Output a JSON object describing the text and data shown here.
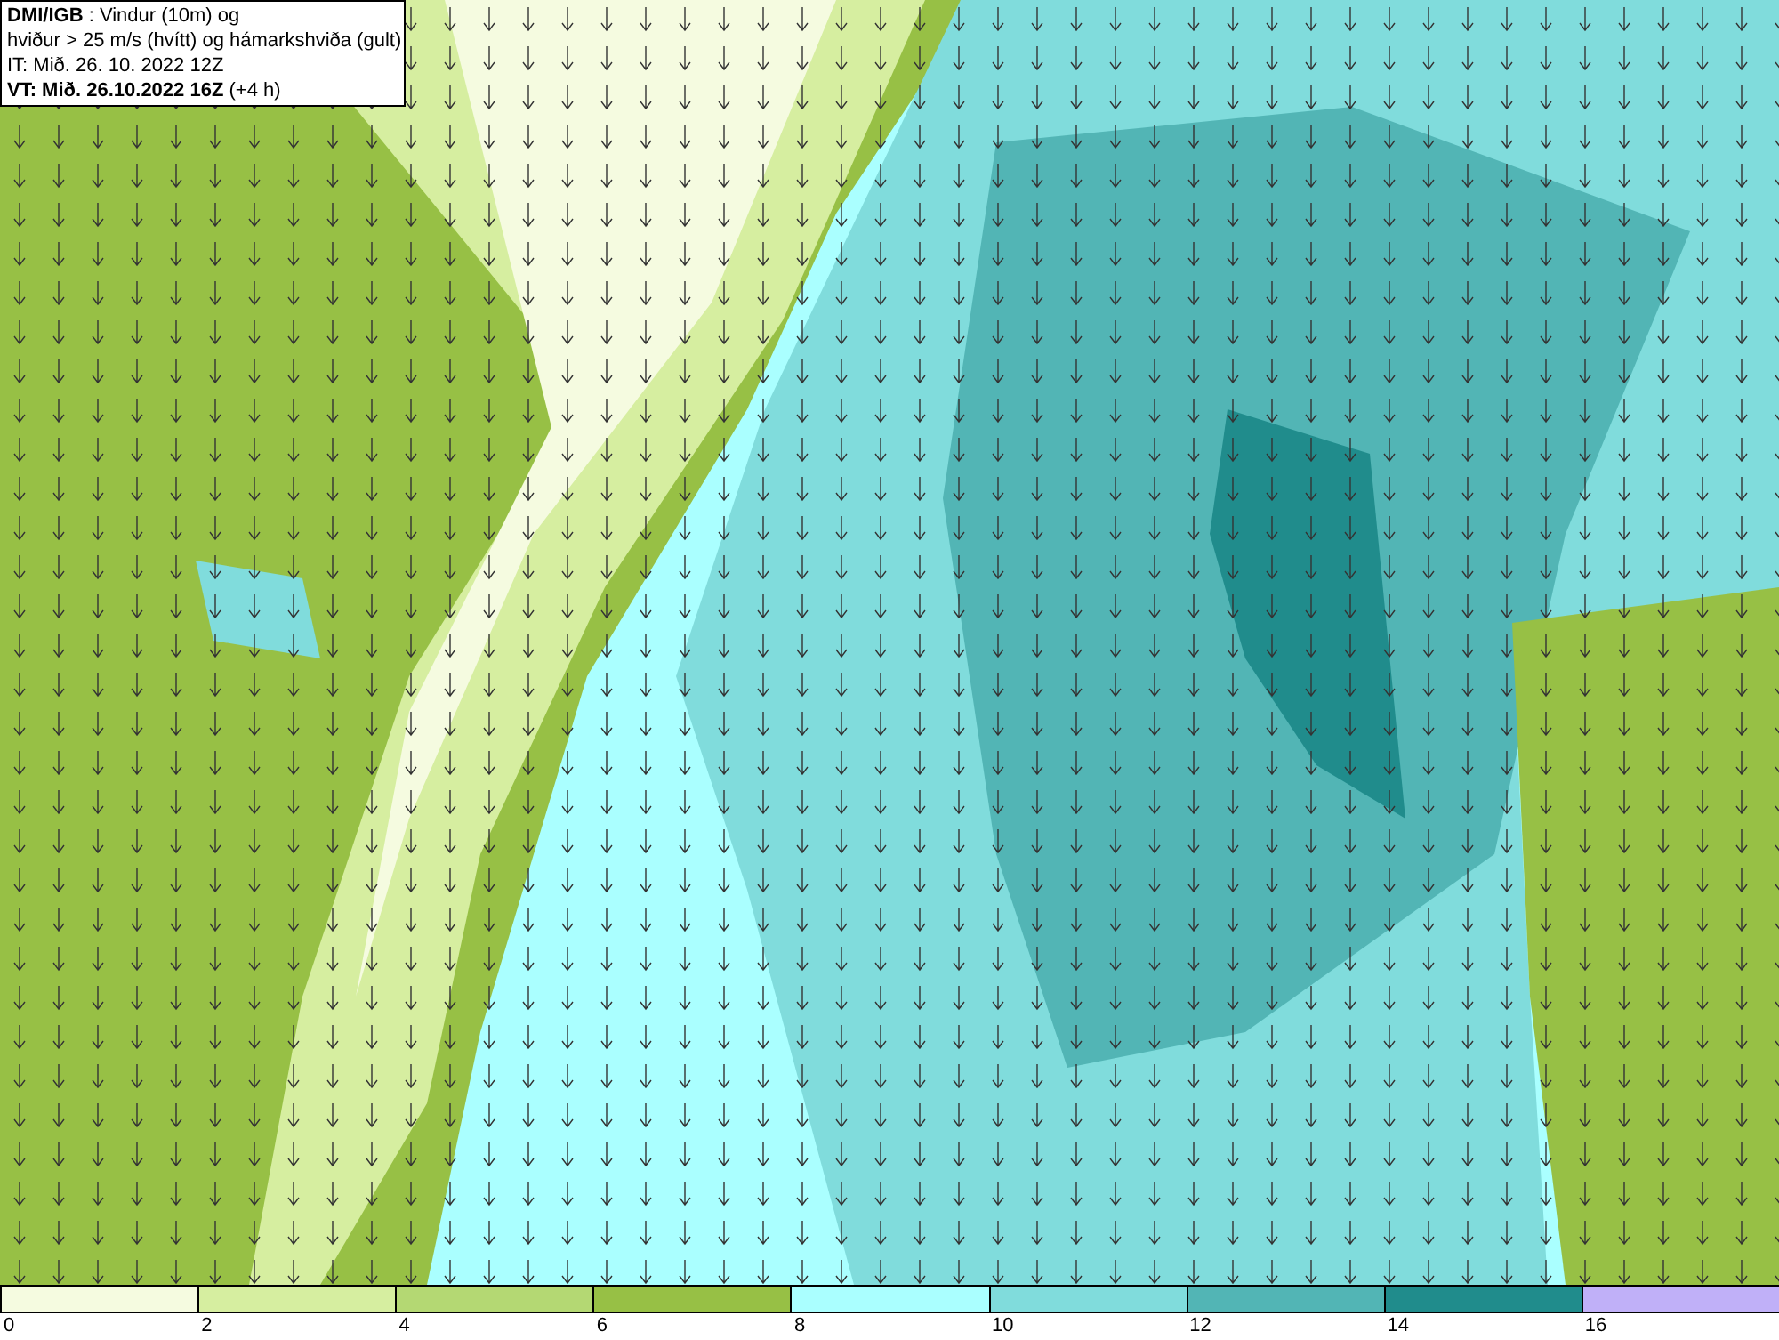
{
  "info_box": {
    "lines": [
      "**DMI/IGB** : Vindur (10m) og",
      "hviður > 25 m/s (hvítt) og hámarkshviða (gult)",
      "IT: Mið. 26. 10. 2022 12Z",
      "**VT: Mið. 26.10.2022 16Z** (+4 h)"
    ]
  },
  "legend": {
    "segments": [
      {
        "color": "#f5fbe0"
      },
      {
        "color": "#d6eea0"
      },
      {
        "color": "#b4d873"
      },
      {
        "color": "#97c045"
      },
      {
        "color": "#aaffff"
      },
      {
        "color": "#80dcdc"
      },
      {
        "color": "#52b5b5"
      },
      {
        "color": "#208c8c"
      },
      {
        "color": "#c0b0f8"
      }
    ],
    "ticks": [
      "0",
      "2",
      "4",
      "6",
      "8",
      "10",
      "12",
      "14",
      "16"
    ]
  }
}
